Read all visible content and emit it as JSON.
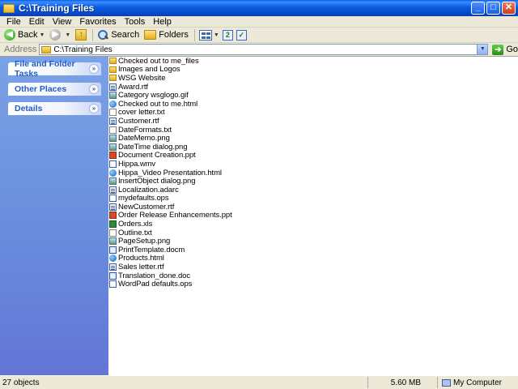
{
  "window": {
    "title": "C:\\Training Files"
  },
  "title_buttons": {
    "minimize": "_",
    "maximize": "□",
    "close": "✕"
  },
  "menu": [
    "File",
    "Edit",
    "View",
    "Favorites",
    "Tools",
    "Help"
  ],
  "toolbar": {
    "back_label": "Back",
    "search_label": "Search",
    "folders_label": "Folders"
  },
  "address": {
    "label": "Address",
    "value": "C:\\Training Files",
    "go_label": "Go"
  },
  "task_pane": {
    "panels": [
      {
        "title": "File and Folder Tasks"
      },
      {
        "title": "Other Places"
      },
      {
        "title": "Details"
      }
    ]
  },
  "files": [
    {
      "name": "Checked out to me_files",
      "icon": "folder-icon"
    },
    {
      "name": "Images and Logos",
      "icon": "folder-icon"
    },
    {
      "name": "WSG Website",
      "icon": "folder-icon"
    },
    {
      "name": "Award.rtf",
      "icon": "rtf-file-icon"
    },
    {
      "name": "Category wsglogo.gif",
      "icon": "image-file-icon"
    },
    {
      "name": "Checked out to me.html",
      "icon": "html-file-icon"
    },
    {
      "name": "cover letter.txt",
      "icon": "text-file-icon"
    },
    {
      "name": "Customer.rtf",
      "icon": "rtf-file-icon"
    },
    {
      "name": "DateFormats.txt",
      "icon": "text-file-icon"
    },
    {
      "name": "DateMemo.png",
      "icon": "image-file-icon"
    },
    {
      "name": "DateTime dialog.png",
      "icon": "image-file-icon"
    },
    {
      "name": "Document Creation.ppt",
      "icon": "ppt-file-icon"
    },
    {
      "name": "Hippa.wmv",
      "icon": "video-file-icon"
    },
    {
      "name": "Hippa_Video Presentation.html",
      "icon": "html-file-icon"
    },
    {
      "name": "InsertObject dialog.png",
      "icon": "image-file-icon"
    },
    {
      "name": "Localization.adarc",
      "icon": "rtf-file-icon"
    },
    {
      "name": "mydefaults.ops",
      "icon": "ops-file-icon"
    },
    {
      "name": "NewCustomer.rtf",
      "icon": "rtf-file-icon"
    },
    {
      "name": "Order Release Enhancements.ppt",
      "icon": "ppt-file-icon"
    },
    {
      "name": "Orders.xls",
      "icon": "xls-file-icon"
    },
    {
      "name": "Outline.txt",
      "icon": "text-file-icon"
    },
    {
      "name": "PageSetup.png",
      "icon": "image-file-icon"
    },
    {
      "name": "PrintTemplate.docm",
      "icon": "doc-file-icon"
    },
    {
      "name": "Products.html",
      "icon": "html-file-icon"
    },
    {
      "name": "Sales letter.rtf",
      "icon": "rtf-file-icon"
    },
    {
      "name": "Translation_done.doc",
      "icon": "doc-file-icon"
    },
    {
      "name": "WordPad defaults.ops",
      "icon": "ops-file-icon"
    }
  ],
  "status": {
    "objects": "27 objects",
    "size": "5.60 MB",
    "location": "My Computer"
  }
}
